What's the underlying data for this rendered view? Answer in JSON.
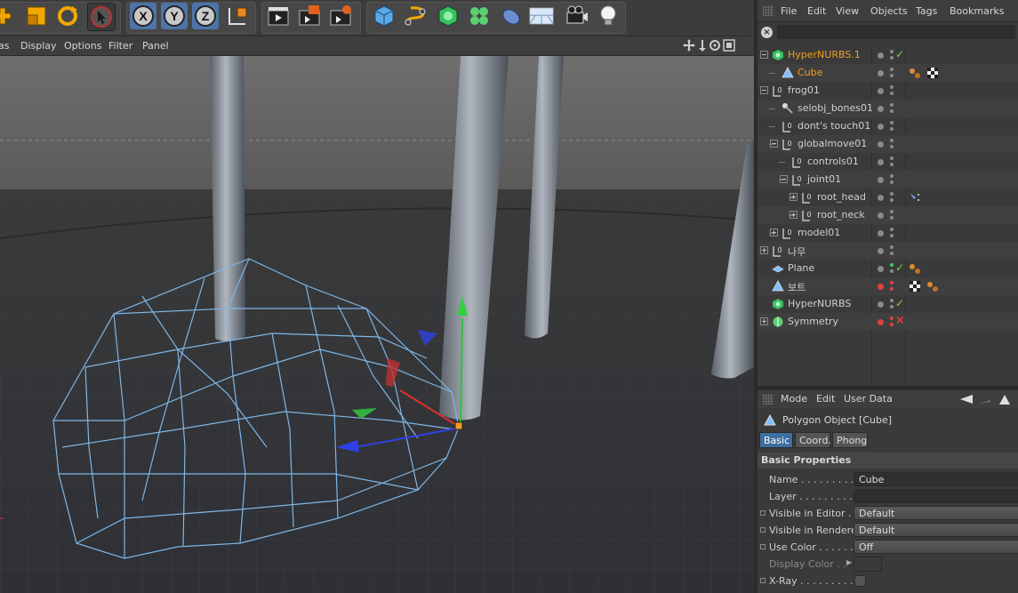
{
  "viewport_menu": [
    "as",
    "Display",
    "Options",
    "Filter",
    "Panel"
  ],
  "objmgr_menu": [
    "File",
    "Edit",
    "View",
    "Objects",
    "Tags",
    "Bookmarks"
  ],
  "search_placeholder": "",
  "objects": [
    {
      "name": "HyperNURBS.1",
      "icon": "hypernurbs-icon",
      "selected": true,
      "check": true
    },
    {
      "name": "Cube",
      "icon": "polygon-object-icon",
      "selected": true
    },
    {
      "name": "frog01",
      "icon": "null-object-icon"
    },
    {
      "name": "selobj_bones01",
      "icon": "bone-selection-icon"
    },
    {
      "name": "dont's touch01",
      "icon": "null-object-icon"
    },
    {
      "name": "globalmove01",
      "icon": "null-object-icon"
    },
    {
      "name": "controls01",
      "icon": "null-object-icon"
    },
    {
      "name": "joint01",
      "icon": "null-object-icon"
    },
    {
      "name": "root_head",
      "icon": "null-object-icon"
    },
    {
      "name": "root_neck",
      "icon": "null-object-icon"
    },
    {
      "name": "model01",
      "icon": "null-object-icon"
    },
    {
      "name": "나무",
      "icon": "null-object-icon"
    },
    {
      "name": "Plane",
      "icon": "plane-icon",
      "check": true
    },
    {
      "name": "보트",
      "icon": "polygon-object-icon"
    },
    {
      "name": "HyperNURBS",
      "icon": "hypernurbs-icon",
      "check": true
    },
    {
      "name": "Symmetry",
      "icon": "symmetry-icon",
      "cross": true
    }
  ],
  "attr_menu": [
    "Mode",
    "Edit",
    "User Data"
  ],
  "attr_title": "Polygon Object [Cube]",
  "attr_tabs": [
    "Basic",
    "Coord.",
    "Phong"
  ],
  "attr_section": "Basic Properties",
  "attributes": [
    {
      "label": "Name . . . . . . . . . .",
      "value": "Cube"
    },
    {
      "label": "Layer . . . . . . . . . .",
      "value": ""
    },
    {
      "label": "Visible in Editor  . .",
      "value": "Default"
    },
    {
      "label": "Visible in Renderer",
      "value": "Default"
    },
    {
      "label": "Use Color . . . . . . .",
      "value": "Off"
    },
    {
      "label": "Display Color . .",
      "value": ""
    },
    {
      "label": "X-Ray . . . . . . . . . .",
      "value": ""
    }
  ],
  "colors": {
    "selected_text": "#f0a020",
    "active_tab": "#3e6e9e",
    "wireframe": "#7eb6e6",
    "check_green": "#7bd44a",
    "cross_red": "#e04040"
  }
}
